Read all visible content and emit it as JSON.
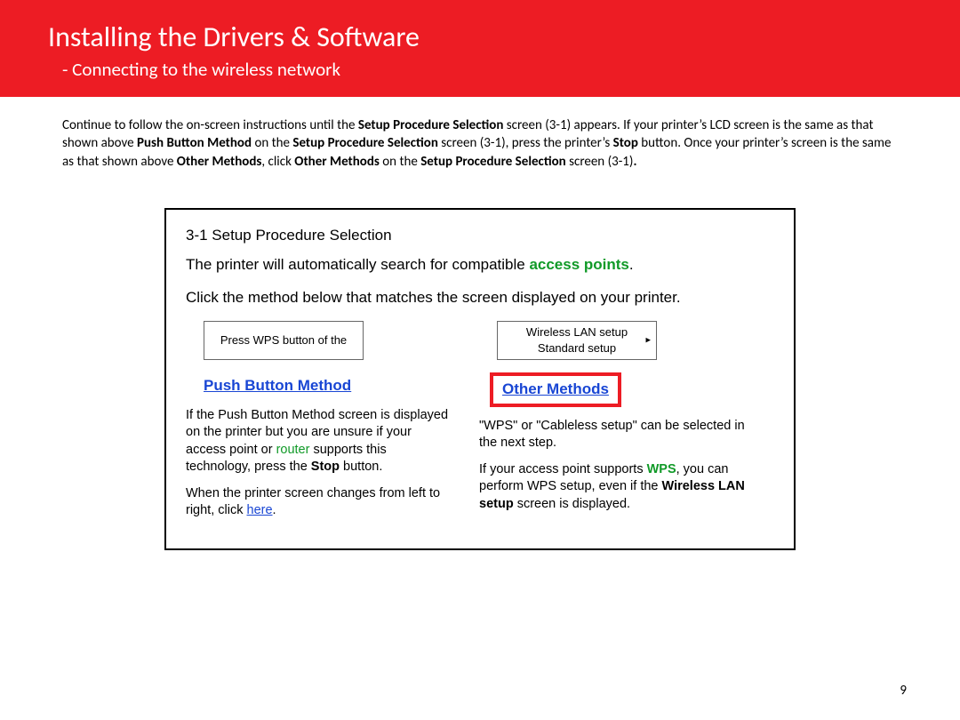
{
  "header": {
    "title": "Installing  the Drivers & Software",
    "subtitle": "-  Connecting  to the wireless network"
  },
  "intro": {
    "p1_a": "Continue to follow the on-screen instructions until the ",
    "b1": "Setup Procedure Selection",
    "p1_b": " screen (3-1) appears.  If your printer’s LCD screen is the same as that shown above ",
    "b2": "Push Button Method",
    "p1_c": " on the ",
    "b3": "Setup Procedure Selection",
    "p1_d": " screen (3-1), press the printer’s ",
    "b4": "Stop",
    "p1_e": " button.  Once your printer’s screen is the same as that shown above ",
    "b5": "Other Methods",
    "p1_f": ", click ",
    "b6": "Other Methods",
    "p1_g": " on the ",
    "b7": "Setup Procedure Selection",
    "p1_h": " screen (3-1)",
    "b8": "."
  },
  "dialog": {
    "heading": "3-1 Setup Procedure Selection",
    "line1_a": "The printer will automatically search for compatible ",
    "line1_green": "access points",
    "line1_b": ".",
    "line2": "Click the method below that matches the screen displayed on your printer.",
    "left": {
      "lcd": "Press WPS button of the",
      "link": "Push Button Method",
      "d1_a": "If the Push Button Method screen is displayed on the printer but you are unsure if your access point or ",
      "d1_green": "router",
      "d1_b": " supports this technology, press the ",
      "d1_bold": "Stop",
      "d1_c": " button.",
      "d2_a": "When the printer screen changes from left to right, click ",
      "d2_here": "here",
      "d2_b": "."
    },
    "right": {
      "lcd": "Wireless LAN setup\nStandard setup",
      "link": "Other Methods",
      "d1": "\"WPS\" or \"Cableless setup\" can be selected in the next step.",
      "d2_a": "If your access point supports ",
      "d2_green": "WPS",
      "d2_b": ", you can perform WPS setup, even if the ",
      "d2_bold": "Wireless LAN setup",
      "d2_c": " screen is displayed."
    }
  },
  "page_number": "9"
}
